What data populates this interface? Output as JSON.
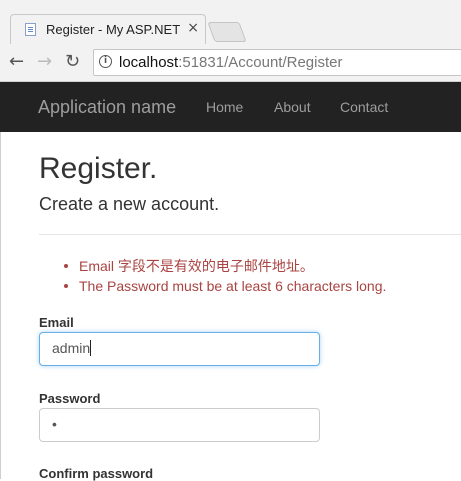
{
  "browser": {
    "tab_title": "Register - My ASP.NET",
    "tab_close": "×",
    "url_host": "localhost",
    "url_rest": ":51831/Account/Register",
    "info_glyph": "i",
    "back_glyph": "←",
    "forward_glyph": "→",
    "reload_glyph": "↻"
  },
  "navbar": {
    "brand": "Application name",
    "links": [
      "Home",
      "About",
      "Contact"
    ]
  },
  "page": {
    "title": "Register.",
    "subtitle": "Create a new account.",
    "errors": [
      "Email 字段不是有效的电子邮件地址。",
      "The Password must be at least 6 characters long."
    ],
    "email_label": "Email",
    "email_value": "admin",
    "password_label": "Password",
    "password_value": "•",
    "confirm_label": "Confirm password"
  },
  "colors": {
    "navbar_bg": "#222222",
    "navbar_text": "#9d9d9d",
    "error_text": "#a94442",
    "focus_border": "#66afe9"
  }
}
